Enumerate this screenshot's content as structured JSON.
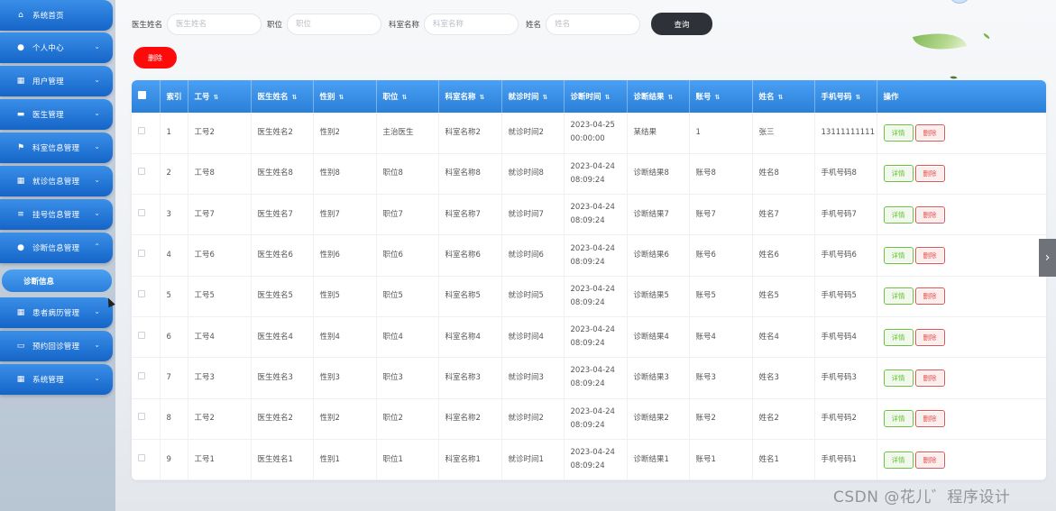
{
  "sidebar": {
    "items": [
      {
        "label": "系统首页",
        "icon": "home-icon",
        "arrow": ""
      },
      {
        "label": "个人中心",
        "icon": "user-icon",
        "arrow": "⌄"
      },
      {
        "label": "用户管理",
        "icon": "grid-icon",
        "arrow": "⌄"
      },
      {
        "label": "医生管理",
        "icon": "chat-icon",
        "arrow": "⌄"
      },
      {
        "label": "科室信息管理",
        "icon": "flag-icon",
        "arrow": "⌄"
      },
      {
        "label": "就诊信息管理",
        "icon": "grid-icon",
        "arrow": "⌄"
      },
      {
        "label": "挂号信息管理",
        "icon": "clipboard-icon",
        "arrow": "⌄"
      },
      {
        "label": "诊断信息管理",
        "icon": "user-icon",
        "arrow": "⌃"
      },
      {
        "label": "患者病历管理",
        "icon": "grid-icon",
        "arrow": "⌄"
      },
      {
        "label": "预约回诊管理",
        "icon": "briefcase-icon",
        "arrow": "⌄"
      },
      {
        "label": "系统管理",
        "icon": "grid-icon",
        "arrow": "⌄"
      }
    ],
    "submenu_active": "诊断信息"
  },
  "search": {
    "doctor_name_label": "医生姓名",
    "doctor_name_placeholder": "医生姓名",
    "position_label": "职位",
    "position_placeholder": "职位",
    "department_label": "科室名称",
    "department_placeholder": "科室名称",
    "name_label": "姓名",
    "name_placeholder": "姓名",
    "query_button": "查询"
  },
  "toolbar": {
    "delete_button": "删除"
  },
  "table": {
    "headers": [
      "",
      "索引",
      "工号",
      "医生姓名",
      "性别",
      "职位",
      "科室名称",
      "就诊时间",
      "诊断时间",
      "诊断结果",
      "账号",
      "姓名",
      "手机号码",
      "操作"
    ],
    "sortable": [
      false,
      false,
      true,
      true,
      true,
      true,
      true,
      true,
      true,
      true,
      true,
      true,
      true,
      false
    ],
    "rows": [
      {
        "index": "1",
        "job_no": "工号2",
        "doctor": "医生姓名2",
        "gender": "性别2",
        "position": "主治医生",
        "dept": "科室名称2",
        "visit_time": "就诊时间2",
        "diag_time": "2023-04-25 00:00:00",
        "result": "某结果",
        "account": "1",
        "name": "张三",
        "phone": "13111111111"
      },
      {
        "index": "2",
        "job_no": "工号8",
        "doctor": "医生姓名8",
        "gender": "性别8",
        "position": "职位8",
        "dept": "科室名称8",
        "visit_time": "就诊时间8",
        "diag_time": "2023-04-24 08:09:24",
        "result": "诊断结果8",
        "account": "账号8",
        "name": "姓名8",
        "phone": "手机号码8"
      },
      {
        "index": "3",
        "job_no": "工号7",
        "doctor": "医生姓名7",
        "gender": "性别7",
        "position": "职位7",
        "dept": "科室名称7",
        "visit_time": "就诊时间7",
        "diag_time": "2023-04-24 08:09:24",
        "result": "诊断结果7",
        "account": "账号7",
        "name": "姓名7",
        "phone": "手机号码7"
      },
      {
        "index": "4",
        "job_no": "工号6",
        "doctor": "医生姓名6",
        "gender": "性别6",
        "position": "职位6",
        "dept": "科室名称6",
        "visit_time": "就诊时间6",
        "diag_time": "2023-04-24 08:09:24",
        "result": "诊断结果6",
        "account": "账号6",
        "name": "姓名6",
        "phone": "手机号码6"
      },
      {
        "index": "5",
        "job_no": "工号5",
        "doctor": "医生姓名5",
        "gender": "性别5",
        "position": "职位5",
        "dept": "科室名称5",
        "visit_time": "就诊时间5",
        "diag_time": "2023-04-24 08:09:24",
        "result": "诊断结果5",
        "account": "账号5",
        "name": "姓名5",
        "phone": "手机号码5"
      },
      {
        "index": "6",
        "job_no": "工号4",
        "doctor": "医生姓名4",
        "gender": "性别4",
        "position": "职位4",
        "dept": "科室名称4",
        "visit_time": "就诊时间4",
        "diag_time": "2023-04-24 08:09:24",
        "result": "诊断结果4",
        "account": "账号4",
        "name": "姓名4",
        "phone": "手机号码4"
      },
      {
        "index": "7",
        "job_no": "工号3",
        "doctor": "医生姓名3",
        "gender": "性别3",
        "position": "职位3",
        "dept": "科室名称3",
        "visit_time": "就诊时间3",
        "diag_time": "2023-04-24 08:09:24",
        "result": "诊断结果3",
        "account": "账号3",
        "name": "姓名3",
        "phone": "手机号码3"
      },
      {
        "index": "8",
        "job_no": "工号2",
        "doctor": "医生姓名2",
        "gender": "性别2",
        "position": "职位2",
        "dept": "科室名称2",
        "visit_time": "就诊时间2",
        "diag_time": "2023-04-24 08:09:24",
        "result": "诊断结果2",
        "account": "账号2",
        "name": "姓名2",
        "phone": "手机号码2"
      },
      {
        "index": "9",
        "job_no": "工号1",
        "doctor": "医生姓名1",
        "gender": "性别1",
        "position": "职位1",
        "dept": "科室名称1",
        "visit_time": "就诊时间1",
        "diag_time": "2023-04-24 08:09:24",
        "result": "诊断结果1",
        "account": "账号1",
        "name": "姓名1",
        "phone": "手机号码1"
      }
    ],
    "detail_button": "详情",
    "delete_button": "删除"
  },
  "side_tab": {
    "label": "›"
  },
  "watermark": "CSDN @花儿゛程序设计",
  "colors": {
    "accent": "#2a7fd8",
    "danger": "#ff0a0a",
    "query_button": "#2e3238",
    "detail_green": "#67c23a",
    "delete_red": "#e05454"
  }
}
